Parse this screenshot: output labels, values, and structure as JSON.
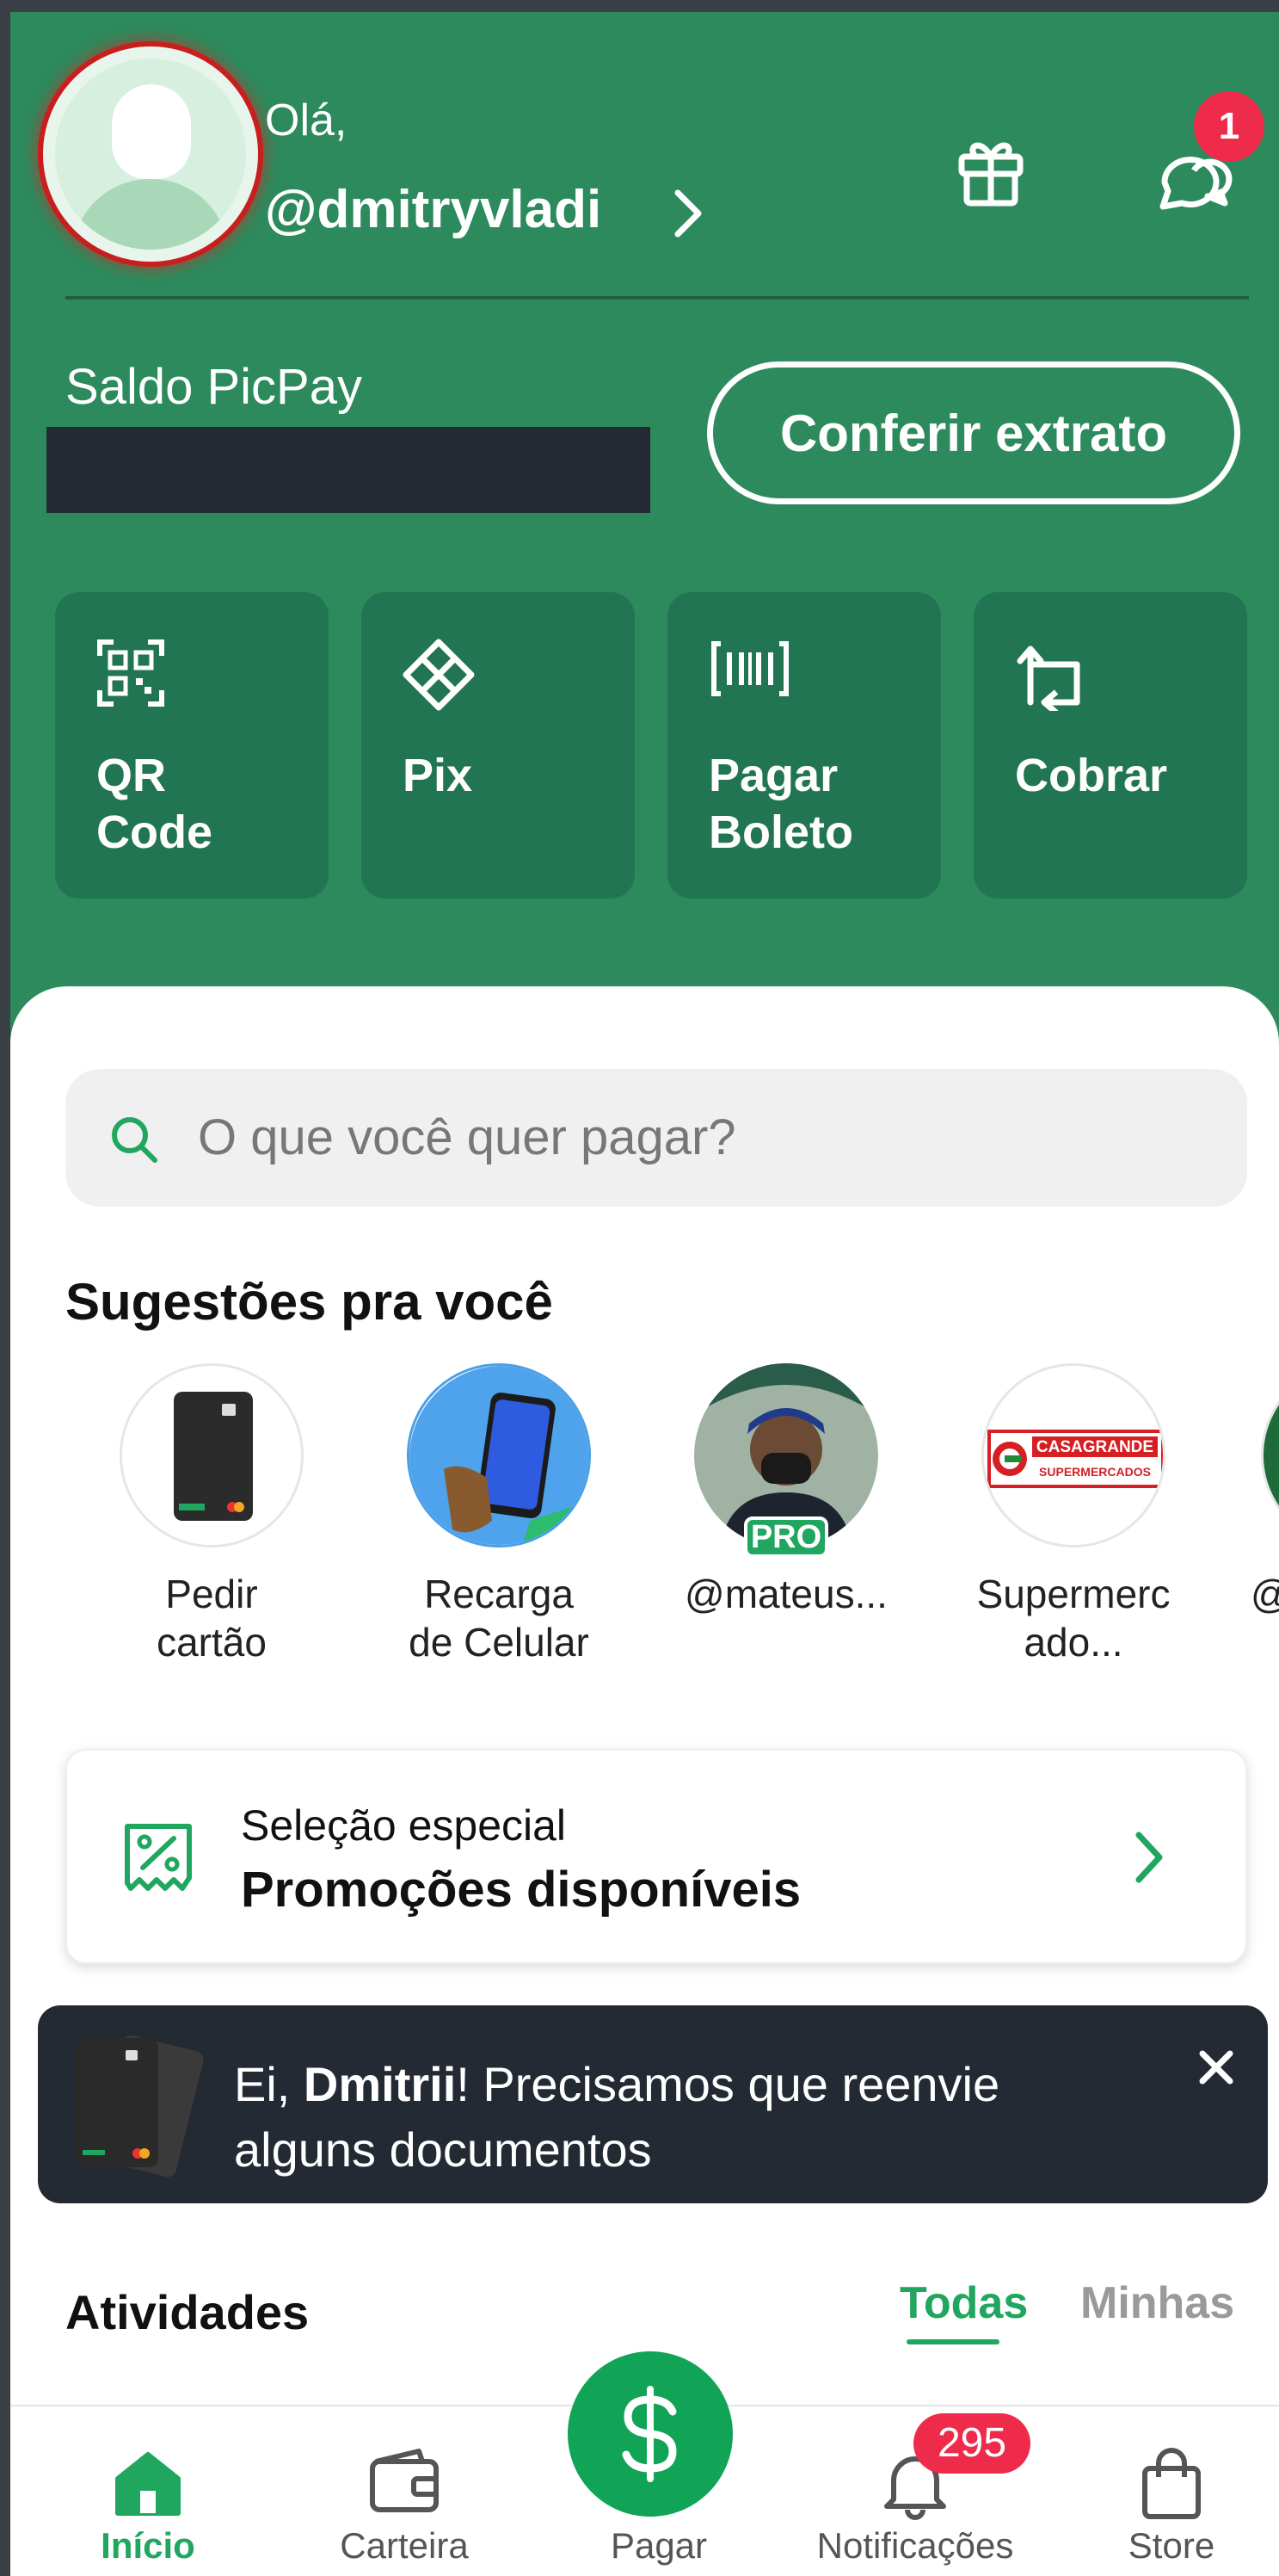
{
  "header": {
    "greeting": "Olá,",
    "username": "@dmitryvladi",
    "chat_badge_count": "1"
  },
  "balance": {
    "label": "Saldo PicPay",
    "statement_button": "Conferir extrato"
  },
  "actions": [
    {
      "label_line1": "QR",
      "label_line2": "Code",
      "icon": "qr-code-icon"
    },
    {
      "label_line1": "Pix",
      "label_line2": "",
      "icon": "pix-icon"
    },
    {
      "label_line1": "Pagar",
      "label_line2": "Boleto",
      "icon": "barcode-icon"
    },
    {
      "label_line1": "Cobrar",
      "label_line2": "",
      "icon": "charge-icon"
    }
  ],
  "search": {
    "placeholder": "O que você quer pagar?"
  },
  "suggestions": {
    "title": "Sugestões pra você",
    "items": [
      {
        "line1": "Pedir",
        "line2": "cartão"
      },
      {
        "line1": "Recarga",
        "line2": "de Celular"
      },
      {
        "line1": "@mateus...",
        "line2": "",
        "badge": "PRO"
      },
      {
        "line1": "Supermerc",
        "line2": "ado..."
      },
      {
        "line1": "@",
        "line2": ""
      }
    ],
    "store_logo_text_1": "CASAGRANDE",
    "store_logo_text_2": "SUPERMERCADOS"
  },
  "promo": {
    "kicker": "Seleção especial",
    "title": "Promoções disponíveis"
  },
  "toast": {
    "prefix": "Ei, ",
    "name": "Dmitrii",
    "line1_rest": "! Precisamos que reenvie",
    "line2": "alguns documentos"
  },
  "activities": {
    "title": "Atividades",
    "tab_all": "Todas",
    "tab_mine": "Minhas"
  },
  "nav": {
    "home": "Início",
    "wallet": "Carteira",
    "pay": "Pagar",
    "notifications": "Notificações",
    "notifications_badge": "295",
    "store": "Store"
  },
  "colors": {
    "brand_green": "#2c8a5c",
    "accent_green": "#21a660",
    "badge_red": "#ee2b4a",
    "dark": "#232a33"
  }
}
